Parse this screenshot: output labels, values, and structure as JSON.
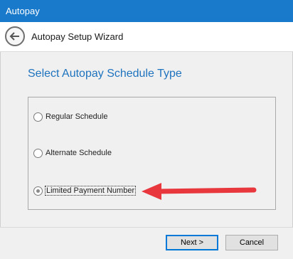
{
  "window": {
    "title": "Autopay"
  },
  "header": {
    "title": "Autopay Setup Wizard",
    "back_icon": "arrow-left-icon"
  },
  "main": {
    "heading": "Select Autopay Schedule Type",
    "options": [
      {
        "label": "Regular Schedule",
        "selected": false
      },
      {
        "label": "Alternate Schedule",
        "selected": false
      },
      {
        "label": "Limited Payment Number",
        "selected": true
      }
    ]
  },
  "annotation": {
    "color": "#e8383d",
    "icon": "red-arrow-icon"
  },
  "footer": {
    "next_label": "Next >",
    "cancel_label": "Cancel"
  },
  "colors": {
    "titlebar": "#1979ca",
    "heading": "#1e73be",
    "accent": "#0078d7"
  }
}
